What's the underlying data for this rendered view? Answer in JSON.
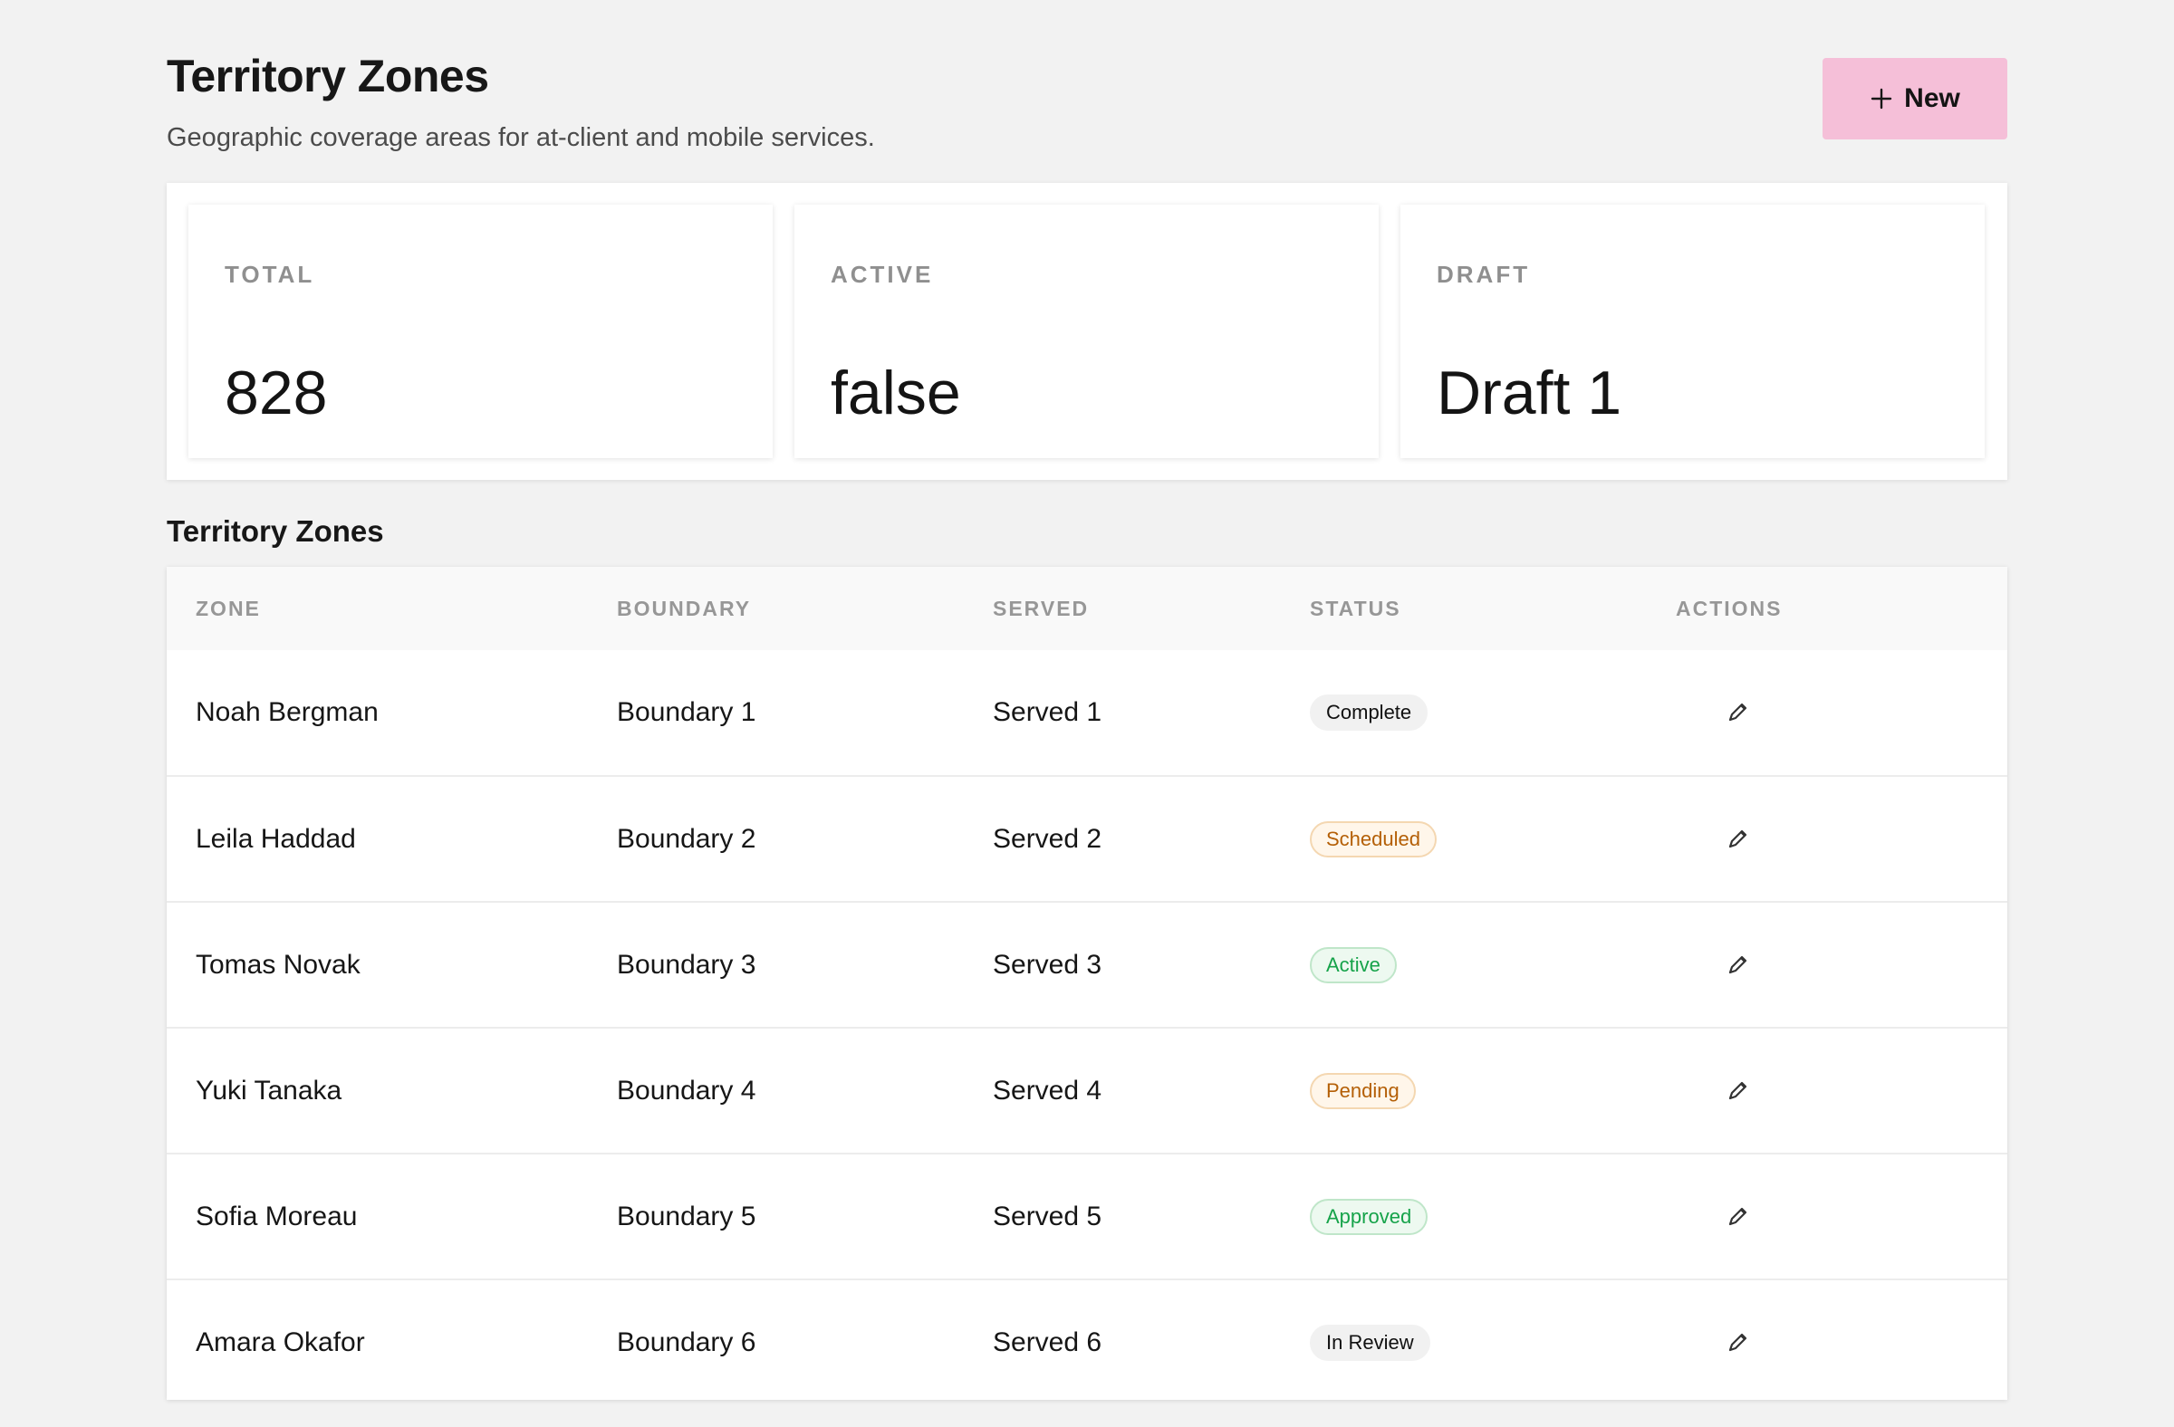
{
  "page": {
    "title": "Territory Zones",
    "subtitle": "Geographic coverage areas for at-client and mobile services."
  },
  "actions": {
    "new_label": "New",
    "new_icon": "plus-icon",
    "new_button_color": "#f5bfd8"
  },
  "stats": [
    {
      "label": "TOTAL",
      "value": "828"
    },
    {
      "label": "ACTIVE",
      "value": "false"
    },
    {
      "label": "DRAFT",
      "value": "Draft 1"
    }
  ],
  "table": {
    "title": "Territory Zones",
    "columns": [
      "ZONE",
      "BOUNDARY",
      "SERVED",
      "STATUS",
      "ACTIONS"
    ],
    "rows": [
      {
        "zone": "Noah Bergman",
        "boundary": "Boundary 1",
        "served": "Served 1",
        "status": "Complete",
        "status_tone": "neutral",
        "action_icon": "pencil-icon"
      },
      {
        "zone": "Leila Haddad",
        "boundary": "Boundary 2",
        "served": "Served 2",
        "status": "Scheduled",
        "status_tone": "orange",
        "action_icon": "pencil-icon"
      },
      {
        "zone": "Tomas Novak",
        "boundary": "Boundary 3",
        "served": "Served 3",
        "status": "Active",
        "status_tone": "green",
        "action_icon": "pencil-icon"
      },
      {
        "zone": "Yuki Tanaka",
        "boundary": "Boundary 4",
        "served": "Served 4",
        "status": "Pending",
        "status_tone": "orange",
        "action_icon": "pencil-icon"
      },
      {
        "zone": "Sofia Moreau",
        "boundary": "Boundary 5",
        "served": "Served 5",
        "status": "Approved",
        "status_tone": "green",
        "action_icon": "pencil-icon"
      },
      {
        "zone": "Amara Okafor",
        "boundary": "Boundary 6",
        "served": "Served 6",
        "status": "In Review",
        "status_tone": "neutral",
        "action_icon": "pencil-icon"
      }
    ]
  },
  "badge_tones": {
    "neutral": {
      "bg": "#f1f1f1",
      "border": "#f1f1f1",
      "text": "#111111"
    },
    "orange": {
      "bg": "#fff6ea",
      "border": "#f4d7b1",
      "text": "#b45f06"
    },
    "green": {
      "bg": "#edf9f0",
      "border": "#bfe6c9",
      "text": "#16a34a"
    }
  }
}
